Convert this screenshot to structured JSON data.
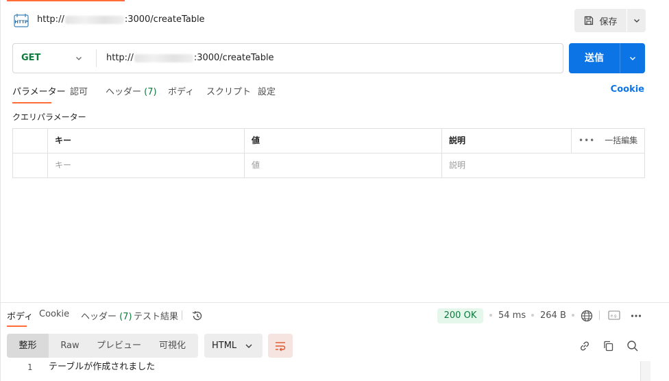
{
  "title_bar": {
    "prefix": "http://",
    "suffix": ":3000/createTable",
    "save_label": "保存"
  },
  "request": {
    "method": "GET",
    "url_prefix": "http://",
    "url_suffix": ":3000/createTable",
    "send_label": "送信"
  },
  "request_tabs": [
    {
      "label": "パラメーター"
    },
    {
      "label": "認可"
    },
    {
      "label": "ヘッダー",
      "count": "(7)"
    },
    {
      "label": "ボディ"
    },
    {
      "label": "スクリプト"
    },
    {
      "label": "設定"
    }
  ],
  "cookie_link": "Cookie",
  "query_params": {
    "section_label": "クエリパラメーター",
    "headers": {
      "key": "キー",
      "value": "値",
      "description": "説明",
      "bulk_edit": "一括編集",
      "more": "•••"
    },
    "placeholders": {
      "key": "キー",
      "value": "値",
      "description": "説明"
    }
  },
  "response": {
    "tabs": [
      {
        "label": "ボディ"
      },
      {
        "label": "Cookie"
      },
      {
        "label": "ヘッダー",
        "count": "(7)"
      },
      {
        "label": "テスト結果"
      }
    ],
    "status": "200 OK",
    "time": "54 ms",
    "size": "264 B",
    "format_tabs": [
      "整形",
      "Raw",
      "プレビュー",
      "可視化"
    ],
    "language": "HTML",
    "more": "•••",
    "body": [
      {
        "line": "1",
        "text": "テーブルが作成されました"
      }
    ]
  },
  "colors": {
    "accent": "#ff6c37",
    "send": "#0c74e4",
    "method_get": "#0b7a3d",
    "status_ok_bg": "#e5f6eb"
  },
  "icons": [
    "http-icon",
    "save-icon",
    "chevron-down-icon",
    "history-icon",
    "globe-icon",
    "card-icon",
    "more-icon",
    "wrap-icon",
    "link-icon",
    "copy-icon",
    "search-icon"
  ]
}
